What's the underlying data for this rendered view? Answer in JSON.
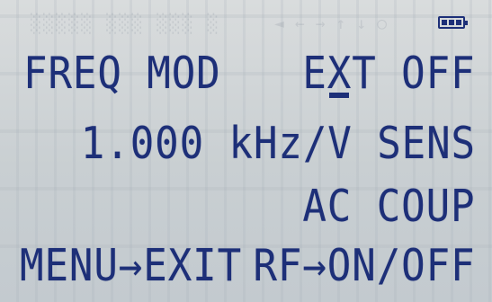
{
  "status": {
    "battery_icon": "battery-full-icon"
  },
  "display": {
    "row1": {
      "left": "FREQ MOD",
      "right": "EXT OFF"
    },
    "row2": {
      "right": "1.000 kHz/V SENS"
    },
    "row3": {
      "right": "AC COUP"
    },
    "row4": {
      "left": "MENU→EXIT",
      "right": "RF→ON/OFF"
    }
  },
  "colors": {
    "lcd_background": "#cfd3d4",
    "segment_text": "#1d2f78"
  }
}
